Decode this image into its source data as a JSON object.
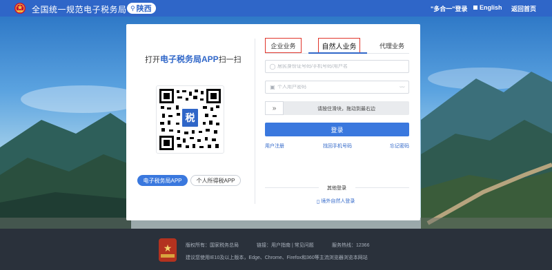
{
  "header": {
    "site_title": "全国统一规范电子税务局",
    "region": "陕西",
    "quick_login": "\"多合一\"登录",
    "language": "English",
    "home": "返回首页"
  },
  "left_panel": {
    "scan_prefix": "打开",
    "scan_app_name": "电子税务局APP",
    "scan_suffix": "扫一扫",
    "qr_badge_text": "税",
    "app_buttons": [
      "电子税务局APP",
      "个人所得税APP"
    ]
  },
  "tabs": [
    {
      "label": "企业业务",
      "active": false
    },
    {
      "label": "自然人业务",
      "active": true
    },
    {
      "label": "代理业务",
      "active": false
    }
  ],
  "form": {
    "username_placeholder": "居民身份证号码/手机号码/用户名",
    "password_placeholder": "个人用户密码",
    "slider_text": "请按住滑块，拖动到最右边",
    "login_label": "登录",
    "register_link": "用户注册",
    "recover_phone_link": "找回手机号码",
    "forgot_password_link": "忘记密码",
    "other_login_title": "其他登录",
    "foreign_login_link": "境外自然人登录"
  },
  "footer": {
    "copyright": "版权所有：国家税务总局",
    "links_label": "链接：用户指南 | 常见问题",
    "hotline": "服务热线：12366",
    "browser_note": "建议您使用IE10及以上版本，Edge、Chrome、Firefox和360等主流浏览器浏览本网站",
    "logo_text": "党政机关"
  },
  "colors": {
    "brand_blue": "#2f66c8",
    "button_blue": "#3a78de",
    "highlight_red": "#e0342a",
    "footer_bg": "#2a313b"
  }
}
